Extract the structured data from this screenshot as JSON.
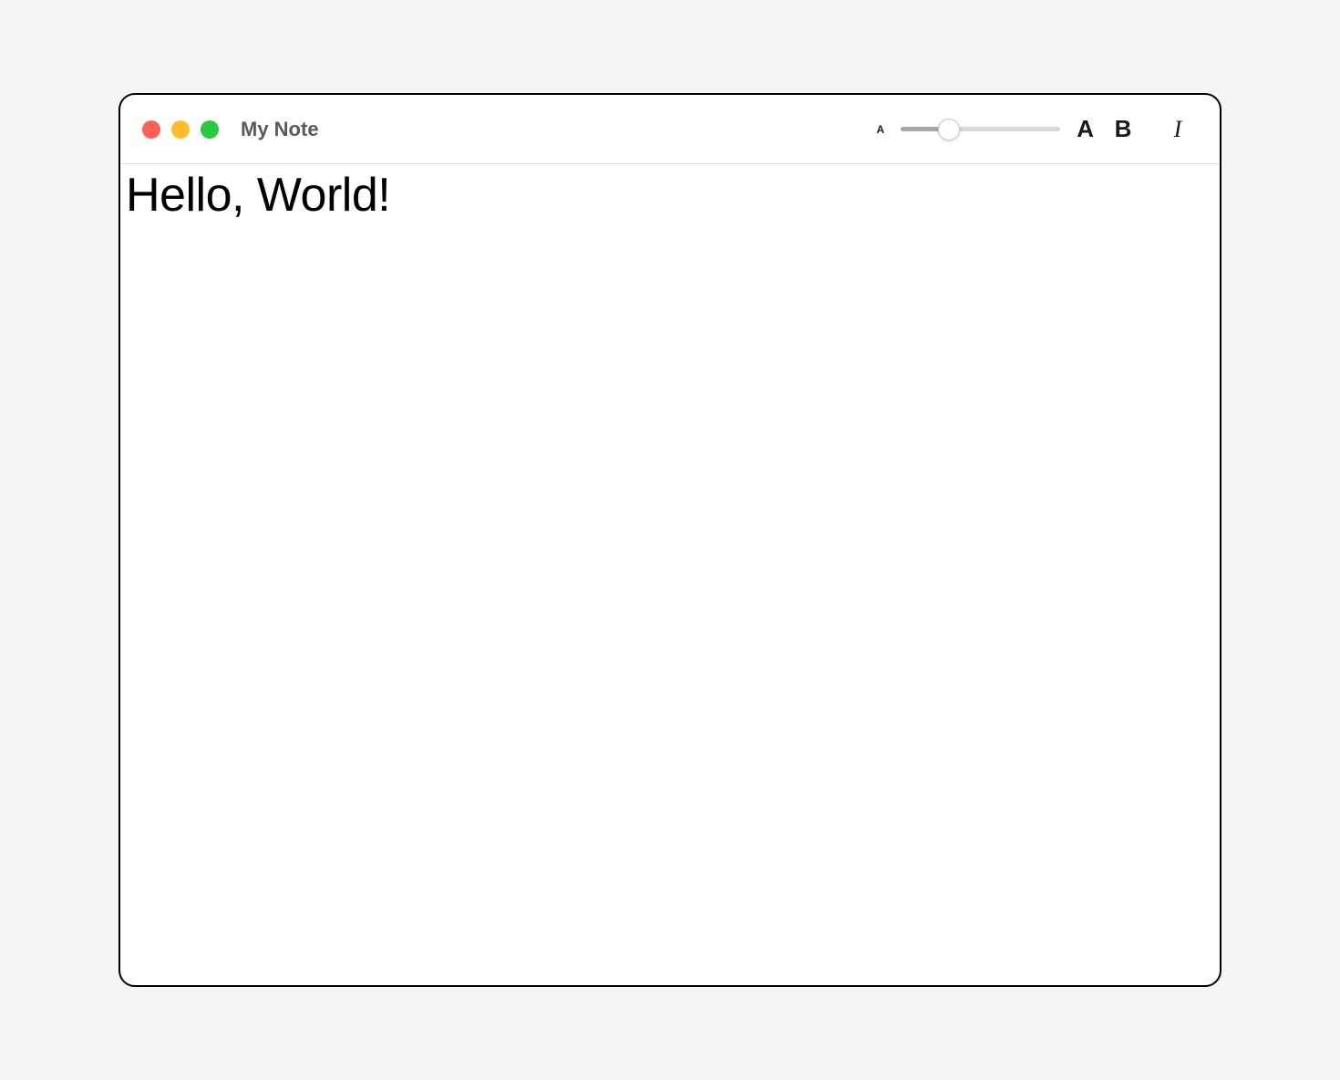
{
  "window": {
    "title": "My Note"
  },
  "toolbar": {
    "font_size_small_label": "A",
    "font_size_large_label": "A",
    "bold_label": "B",
    "italic_label": "I",
    "slider_percent": 30
  },
  "content": {
    "text": "Hello, World!"
  },
  "colors": {
    "traffic_red": "#ff5f57",
    "traffic_yellow": "#febc2e",
    "traffic_green": "#28c840"
  }
}
